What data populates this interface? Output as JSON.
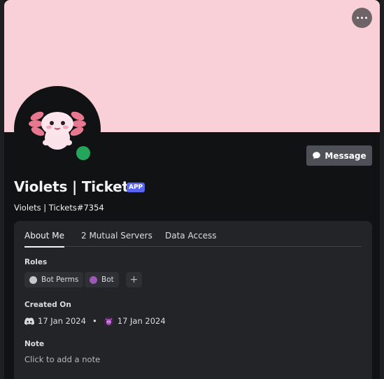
{
  "profile": {
    "display_name": "Violets | Tickets",
    "badge": "APP",
    "username": "Violets | Tickets#7354",
    "message_label": "Message",
    "avatar_icon": "axolotl-avatar",
    "status": "online"
  },
  "tabs": [
    {
      "label": "About Me",
      "active": true
    },
    {
      "label": "2 Mutual Servers",
      "active": false
    },
    {
      "label": "Data Access",
      "active": false
    }
  ],
  "roles": {
    "label": "Roles",
    "items": [
      {
        "name": "Bot Perms",
        "color": "#c4c9ce"
      },
      {
        "name": "Bot",
        "color": "#9b59b6"
      }
    ],
    "add_label": "+"
  },
  "created_on": {
    "label": "Created On",
    "discord_date": "17 Jan 2024",
    "separator": "•",
    "server_date": "17 Jan 2024"
  },
  "note": {
    "label": "Note",
    "placeholder": "Click to add a note"
  },
  "colors": {
    "banner": "#f9d0d8",
    "background": "#111214",
    "card": "#232428",
    "status_online": "#23a55a",
    "badge": "#5865f2"
  }
}
